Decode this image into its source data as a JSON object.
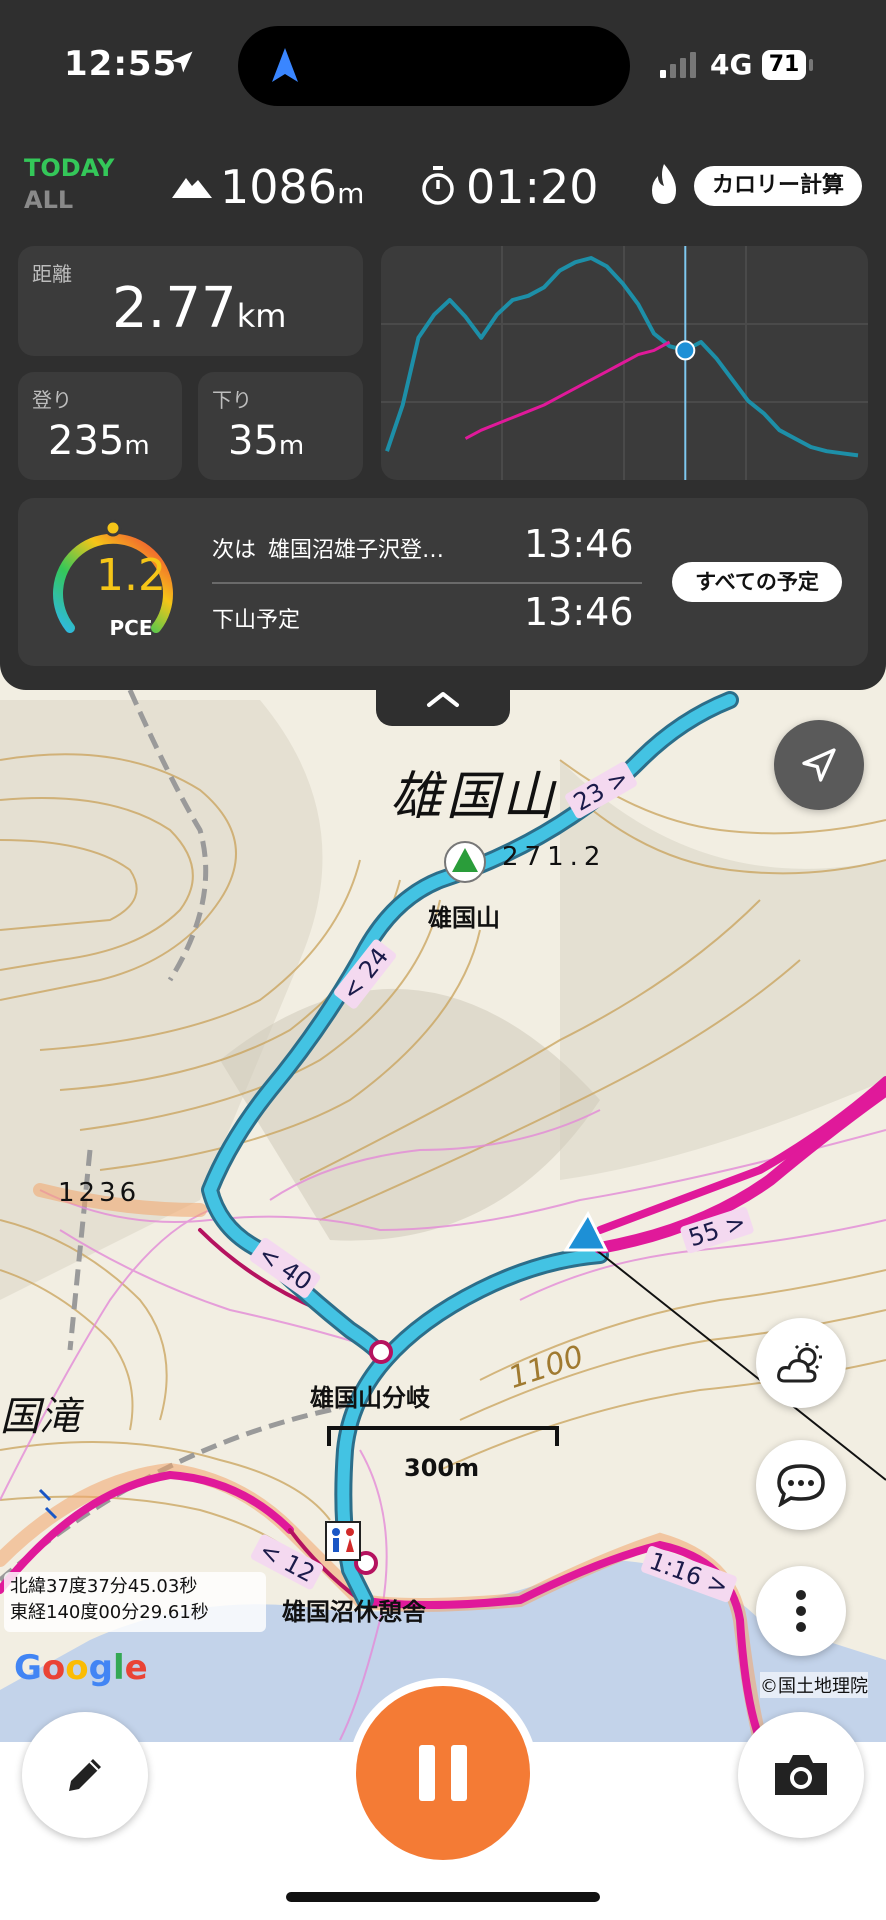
{
  "status_bar": {
    "time": "12:55",
    "network": "4G",
    "battery": "71"
  },
  "header": {
    "today_label": "TODAY",
    "all_label": "ALL",
    "elevation_value": "1086",
    "elevation_unit": "m",
    "elapsed_time": "01:20",
    "calorie_button": "カロリー計算"
  },
  "stats": {
    "distance_label": "距離",
    "distance_value": "2.77",
    "distance_unit": "km",
    "ascent_label": "登り",
    "ascent_value": "235",
    "ascent_unit": "m",
    "descent_label": "下り",
    "descent_value": "35",
    "descent_unit": "m"
  },
  "chart_data": {
    "type": "line",
    "title": "",
    "xlabel": "",
    "ylabel": "",
    "grid": true,
    "series": [
      {
        "color": "#1d8fa8",
        "values": [
          0.08,
          0.3,
          0.62,
          0.73,
          0.8,
          0.72,
          0.62,
          0.73,
          0.8,
          0.82,
          0.86,
          0.94,
          0.98,
          1.0,
          0.96,
          0.88,
          0.78,
          0.64,
          0.58,
          0.56,
          0.6,
          0.52,
          0.42,
          0.32,
          0.26,
          0.18,
          0.14,
          0.1,
          0.08,
          0.07,
          0.06
        ]
      },
      {
        "color": "#e0199a",
        "values": [
          null,
          null,
          null,
          null,
          null,
          0.14,
          0.18,
          0.21,
          0.24,
          0.27,
          0.3,
          0.34,
          0.38,
          0.42,
          0.46,
          0.5,
          0.54,
          0.56,
          0.6,
          null,
          null,
          null,
          null,
          null,
          null,
          null,
          null,
          null,
          null,
          null,
          null
        ]
      }
    ],
    "marker_index": 19,
    "marker_color": "#1e90d6"
  },
  "plan": {
    "pce_value": "1.2",
    "pce_label": "PCE",
    "next_label": "次は",
    "next_destination": "雄国沼雄子沢登…",
    "next_time": "13:46",
    "descent_label": "下山予定",
    "descent_time": "13:46",
    "all_plans_button": "すべての予定"
  },
  "map": {
    "peak_name_large": "雄国山",
    "peak_height": "271.2",
    "peak_name": "雄国山",
    "height_1236": "1236",
    "fork_name": "雄国山分岐",
    "shelter_name": "雄国沼休憩舎",
    "waterfall_text": "国滝",
    "contour_1100": "1100",
    "scale_label": "300m",
    "coords_lat": "北緯37度37分45.03秒",
    "coords_lon": "東経140度00分29.61秒",
    "google_label": "Google",
    "attribution": "©国土地理院",
    "segments": {
      "s23": "23 >",
      "s24": "< 24",
      "s40": "< 40",
      "s55": "55 >",
      "s12": "< 12",
      "s116": "1:16 >"
    }
  },
  "colors": {
    "accent": "#f47b35",
    "route": "#3bb7d6",
    "track": "#e0199a",
    "today": "#34c759"
  }
}
